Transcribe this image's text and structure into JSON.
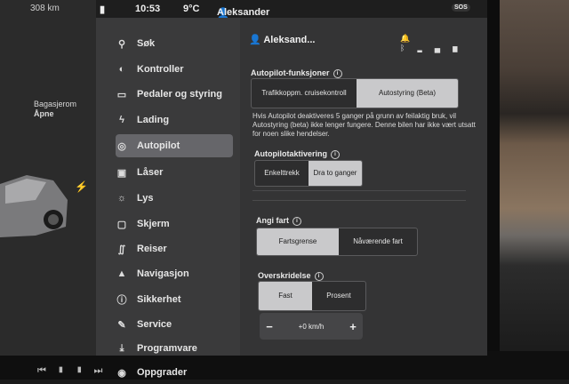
{
  "statusbar": {
    "range": "308 km",
    "time": "10:53",
    "temp": "9°C",
    "user": "Aleksander",
    "sos": "SOS"
  },
  "car": {
    "trunk_label": "Bagasjerom",
    "trunk_action": "Åpne"
  },
  "sidebar": {
    "items": [
      {
        "label": "Søk",
        "icon": "search-icon"
      },
      {
        "label": "Kontroller",
        "icon": "toggle-icon"
      },
      {
        "label": "Pedaler og styring",
        "icon": "car-icon"
      },
      {
        "label": "Lading",
        "icon": "bolt-icon"
      },
      {
        "label": "Autopilot",
        "icon": "steering-wheel-icon"
      },
      {
        "label": "Låser",
        "icon": "lock-icon"
      },
      {
        "label": "Lys",
        "icon": "sun-icon"
      },
      {
        "label": "Skjerm",
        "icon": "display-icon"
      },
      {
        "label": "Reiser",
        "icon": "route-icon"
      },
      {
        "label": "Navigasjon",
        "icon": "navigation-icon"
      },
      {
        "label": "Sikkerhet",
        "icon": "info-icon"
      },
      {
        "label": "Service",
        "icon": "wrench-icon"
      },
      {
        "label": "Programvare",
        "icon": "download-icon"
      },
      {
        "label": "Oppgrader",
        "icon": "bag-icon"
      }
    ],
    "active": "Autopilot"
  },
  "main": {
    "profile_name": "Aleksand...",
    "autopilot_features": {
      "title": "Autopilot-funksjoner",
      "options": [
        "Trafikkoppm. cruisekontroll",
        "Autostyring (Beta)"
      ],
      "selected": "Autostyring (Beta)"
    },
    "description": "Hvis Autopilot deaktiveres 5 ganger på grunn av feilaktig bruk, vil Autostyring (beta) ikke lenger fungere. Denne bilen har ikke vært utsatt for noen slike hendelser.",
    "activation": {
      "title": "Autopilotaktivering",
      "options": [
        "Enkelttrekk",
        "Dra to ganger"
      ],
      "selected": "Dra to ganger"
    },
    "set_speed": {
      "title": "Angi fart",
      "options": [
        "Fartsgrense",
        "Nåværende fart"
      ],
      "selected": "Fartsgrense"
    },
    "offset": {
      "title": "Overskridelse",
      "options": [
        "Fast",
        "Prosent"
      ],
      "selected": "Fast",
      "value": "+0 km/h",
      "minus": "−",
      "plus": "+"
    }
  }
}
